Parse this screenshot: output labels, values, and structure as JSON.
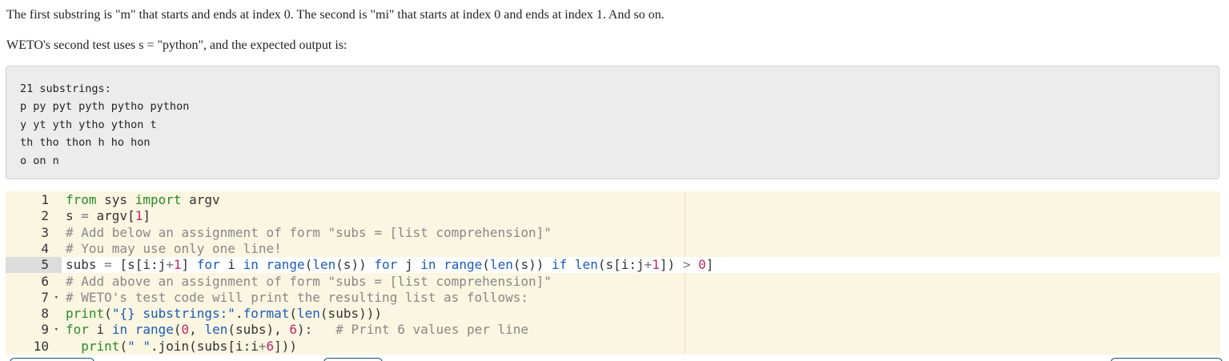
{
  "paragraphs": {
    "p1": "The first substring is \"m\" that starts and ends at index 0. The second is \"mi\" that starts at index 0 and ends at index 1. And so on.",
    "p2": "WETO's second test uses s = \"python\", and the expected output is:"
  },
  "output": {
    "lines": [
      "21 substrings:",
      "p py pyt pyth pytho python",
      "y yt yth ytho ython t",
      "th tho thon h ho hon",
      "o on n"
    ]
  },
  "editor": {
    "active_line": 5,
    "lines": [
      {
        "num": "1",
        "fold": ""
      },
      {
        "num": "2",
        "fold": ""
      },
      {
        "num": "3",
        "fold": ""
      },
      {
        "num": "4",
        "fold": ""
      },
      {
        "num": "5",
        "fold": ""
      },
      {
        "num": "6",
        "fold": ""
      },
      {
        "num": "7",
        "fold": "▾"
      },
      {
        "num": "8",
        "fold": ""
      },
      {
        "num": "9",
        "fold": "▾"
      },
      {
        "num": "10",
        "fold": ""
      }
    ],
    "code": {
      "l1": {
        "kw_from": "from",
        "mod": " sys ",
        "kw_import": "import",
        "rest": " argv"
      },
      "l2": {
        "a": "s ",
        "eq": "=",
        "b": " argv[",
        "n": "1",
        "c": "]"
      },
      "l3": {
        "comment": "# Add below an assignment of form \"subs = [list comprehension]\""
      },
      "l4": {
        "comment": "# You may use only one line!"
      },
      "l5": {
        "a": "subs ",
        "eq": "=",
        "b": " [s[i:j",
        "plus1": "+",
        "one1": "1",
        "c": "] ",
        "for1": "for",
        "d": " i ",
        "in1": "in",
        "e": " ",
        "range1": "range",
        "f": "(",
        "len1": "len",
        "g": "(s)) ",
        "for2": "for",
        "h": " j ",
        "in2": "in",
        "i": " ",
        "range2": "range",
        "j": "(",
        "len2": "len",
        "k": "(s)) ",
        "if1": "if",
        "l": " ",
        "len3": "len",
        "m": "(s[i:j",
        "plus2": "+",
        "one2": "1",
        "n": "]) ",
        "gt": ">",
        "o": " ",
        "zero": "0",
        "p": "]"
      },
      "l6": {
        "comment": "# Add above an assignment of form \"subs = [list comprehension]\""
      },
      "l7": {
        "comment": "# WETO's test code will print the resulting list as follows:"
      },
      "l8": {
        "print": "print",
        "a": "(",
        "str": "\"{} substrings:\"",
        "b": ".",
        "format": "format",
        "c": "(",
        "len": "len",
        "d": "(subs)))"
      },
      "l9": {
        "for": "for",
        "a": " i ",
        "in": "in",
        "b": " ",
        "range": "range",
        "c": "(",
        "zero": "0",
        "d": ", ",
        "len": "len",
        "e": "(subs), ",
        "six": "6",
        "f": "):   ",
        "comment": "# Print 6 values per line"
      },
      "l10": {
        "indent": "  ",
        "print": "print",
        "a": "(",
        "str": "\" \"",
        "b": ".join(subs[i:i",
        "plus": "+",
        "six": "6",
        "c": "]))"
      }
    }
  }
}
